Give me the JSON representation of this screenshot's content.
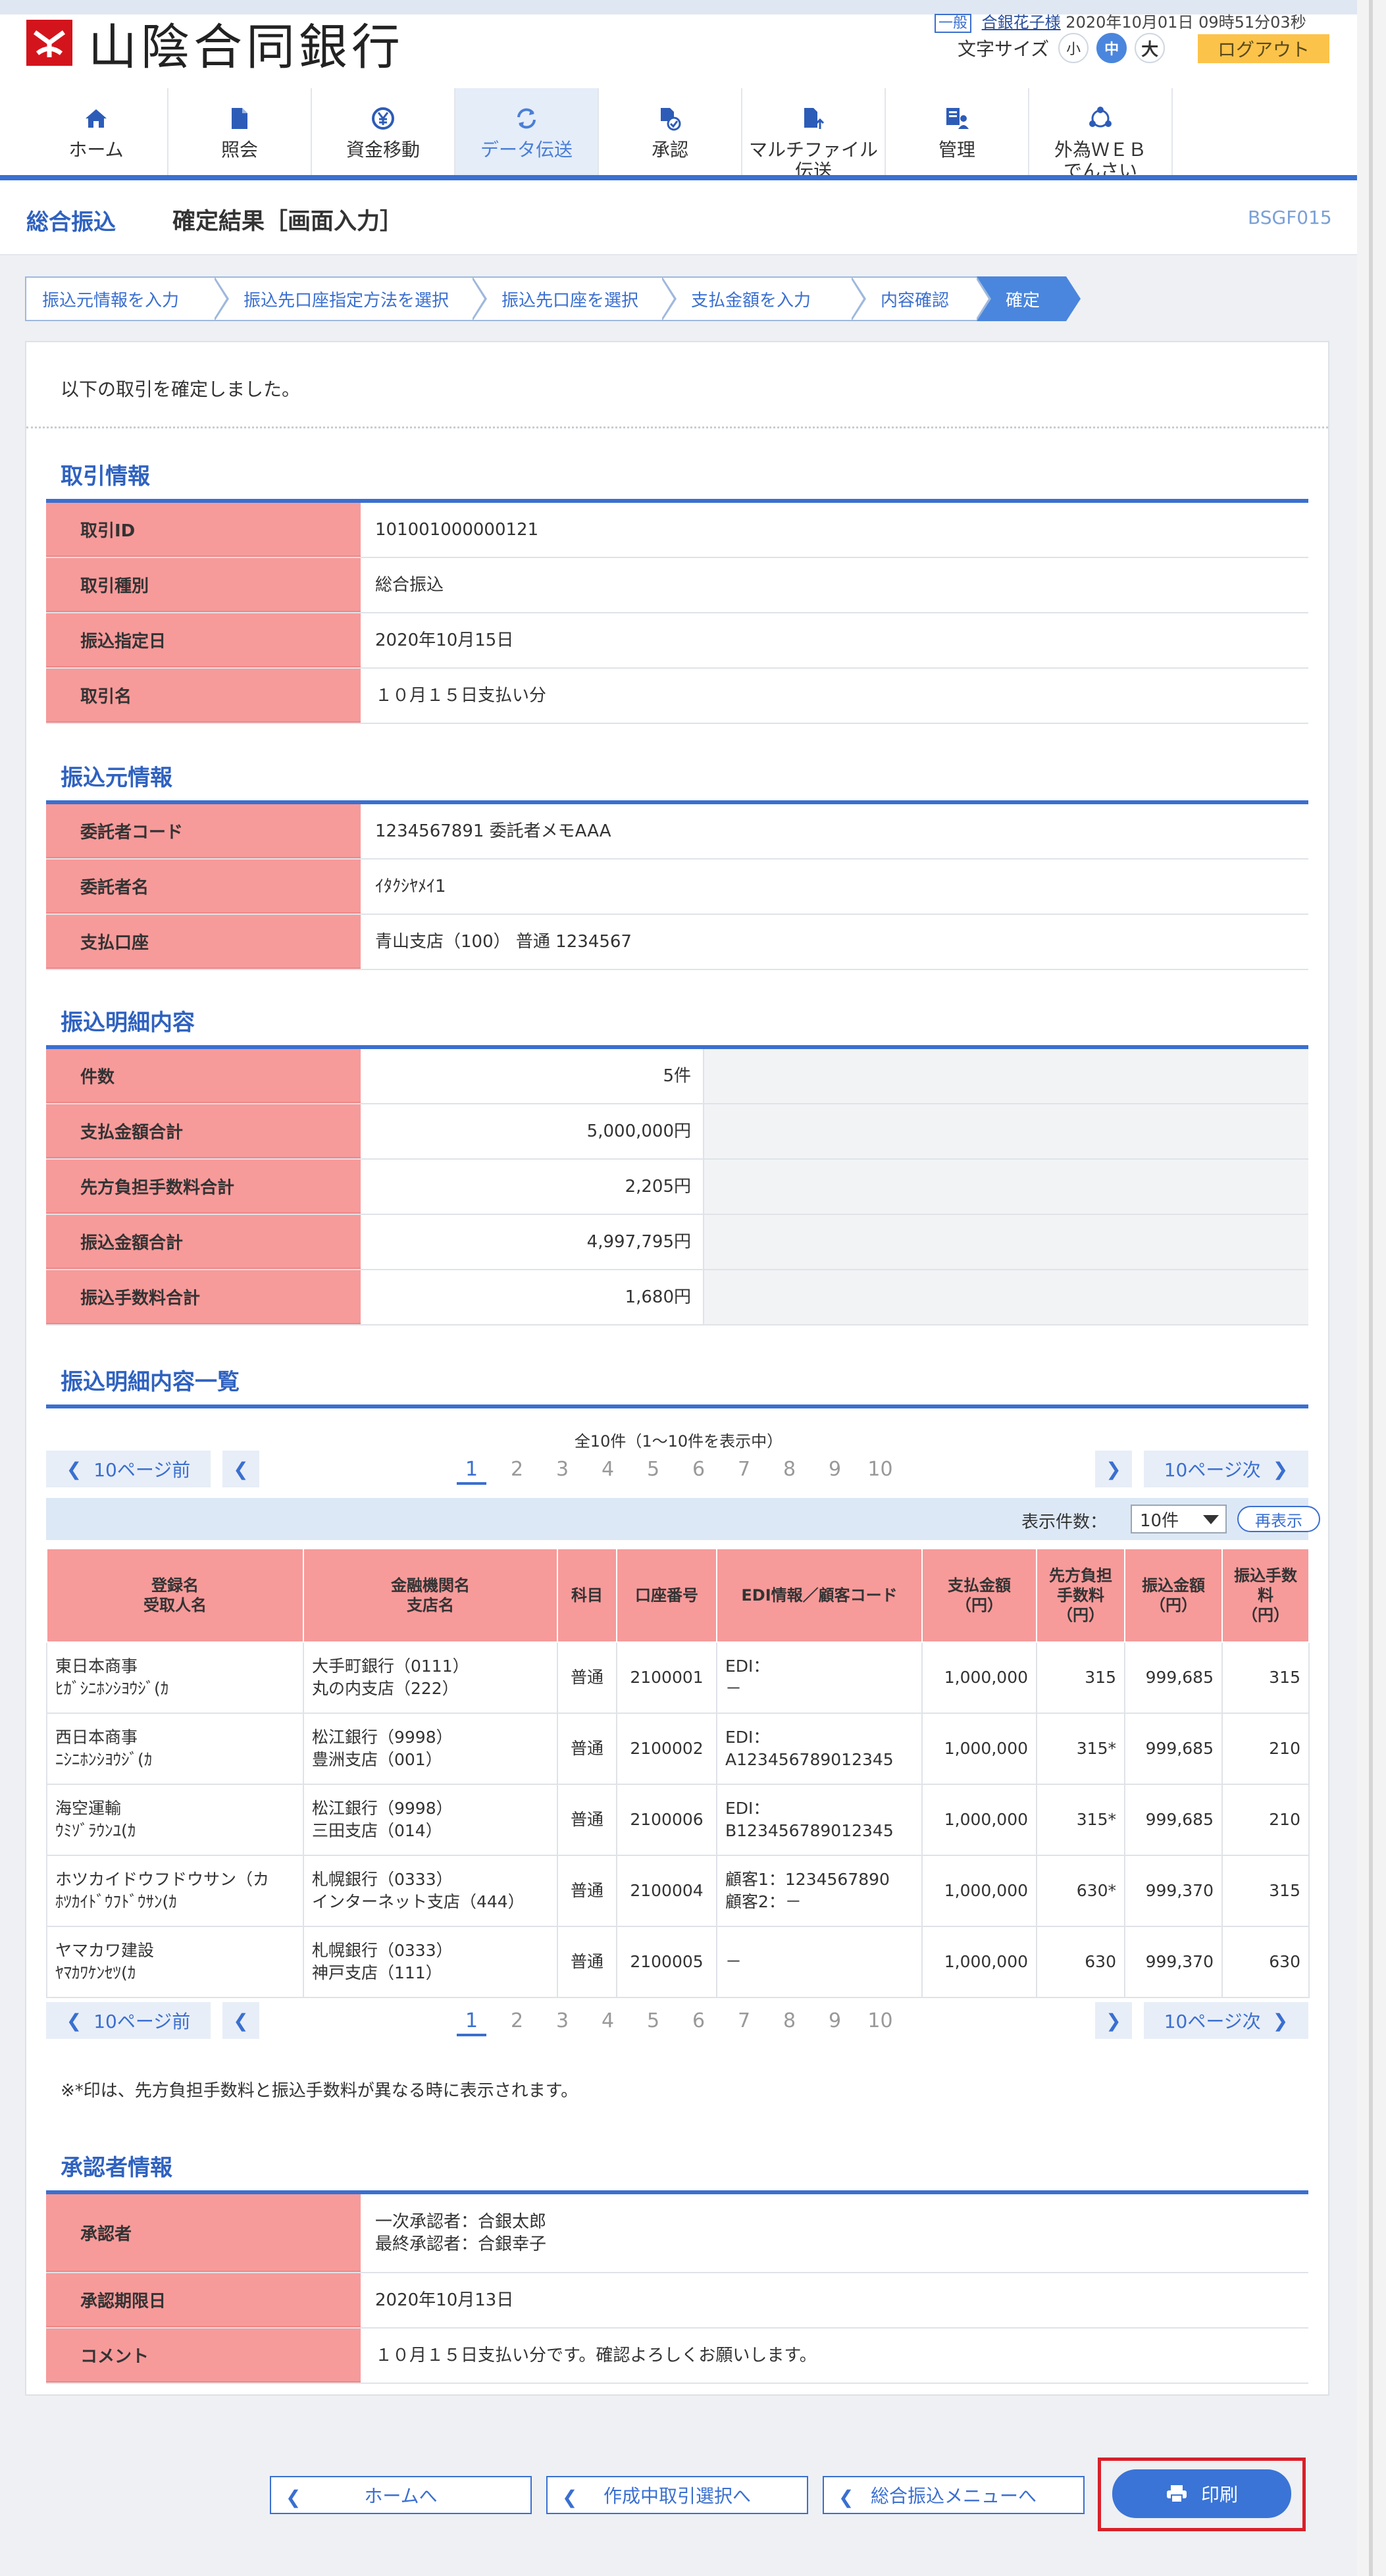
{
  "header": {
    "logo_text": "山陰合同銀行",
    "user_tag": "一般",
    "user_name": "合銀花子様",
    "login_time": "2020年10月01日 09時51分03秒",
    "font_size_label": "文字サイズ",
    "font_small": "小",
    "font_medium": "中",
    "font_large": "大",
    "logout_label": "ログアウト"
  },
  "nav": [
    {
      "label": "ホーム",
      "icon": "home-icon"
    },
    {
      "label": "照会",
      "icon": "document-icon"
    },
    {
      "label": "資金移動",
      "icon": "yen-transfer-icon"
    },
    {
      "label": "データ伝送",
      "icon": "refresh-icon"
    },
    {
      "label": "承認",
      "icon": "approve-document-icon"
    },
    {
      "label": "マルチファイル\n伝送",
      "icon": "file-upload-icon"
    },
    {
      "label": "管理",
      "icon": "admin-icon"
    },
    {
      "label": "外為ＷＥＢ\nでんさい",
      "icon": "globe-link-icon"
    }
  ],
  "titlebar": {
    "category": "総合振込",
    "title": "確定結果［画面入力］",
    "screen_code": "BSGF015"
  },
  "steps": [
    "振込元情報を入力",
    "振込先口座指定方法を選択",
    "振込先口座を選択",
    "支払金額を入力",
    "内容確認",
    "確定"
  ],
  "message": "以下の取引を確定しました。",
  "transaction": {
    "title": "取引情報",
    "rows": [
      {
        "key": "取引ID",
        "value": "101001000000121"
      },
      {
        "key": "取引種別",
        "value": "総合振込"
      },
      {
        "key": "振込指定日",
        "value": "2020年10月15日"
      },
      {
        "key": "取引名",
        "value": "１０月１５日支払い分"
      }
    ]
  },
  "source": {
    "title": "振込元情報",
    "rows": [
      {
        "key": "委託者コード",
        "value": "1234567891 委託者メモAAA"
      },
      {
        "key": "委託者名",
        "value": "ｲﾀｸｼﾔﾒｲ1"
      },
      {
        "key": "支払口座",
        "value": "青山支店（100） 普通 1234567"
      }
    ]
  },
  "summary": {
    "title": "振込明細内容",
    "rows": [
      {
        "key": "件数",
        "value": "5件"
      },
      {
        "key": "支払金額合計",
        "value": "5,000,000円"
      },
      {
        "key": "先方負担手数料合計",
        "value": "2,205円"
      },
      {
        "key": "振込金額合計",
        "value": "4,997,795円"
      },
      {
        "key": "振込手数料合計",
        "value": "1,680円"
      }
    ]
  },
  "details": {
    "title": "振込明細内容一覧",
    "info": "全10件（1～10件を表示中）",
    "prev10": "10ページ前",
    "next10": "10ページ次",
    "pages": [
      "1",
      "2",
      "3",
      "4",
      "5",
      "6",
      "7",
      "8",
      "9",
      "10"
    ],
    "current_page": "1",
    "display_count_label": "表示件数：",
    "display_count": "10件",
    "redisplay": "再表示",
    "headers": [
      "登録名\n受取人名",
      "金融機関名\n支店名",
      "科目",
      "口座番号",
      "EDI情報／顧客コード",
      "支払金額\n（円）",
      "先方負担\n手数料\n（円）",
      "振込金額\n（円）",
      "振込手数\n料\n（円）"
    ],
    "rows": [
      [
        "東日本商事\nﾋｶﾞｼﾆﾎﾝｼﾖｳｼﾞ(ｶ",
        "大手町銀行（0111）\n丸の内支店（222）",
        "普通",
        "2100001",
        "EDI：\n－",
        "1,000,000",
        "315",
        "999,685",
        "315"
      ],
      [
        "西日本商事\nﾆｼﾆﾎﾝｼﾖｳｼﾞ(ｶ",
        "松江銀行（9998）\n豊洲支店（001）",
        "普通",
        "2100002",
        "EDI：\nA123456789012345",
        "1,000,000",
        "315*",
        "999,685",
        "210"
      ],
      [
        "海空運輸\nｳﾐｿﾞﾗｳﾝﾕ(ｶ",
        "松江銀行（9998）\n三田支店（014）",
        "普通",
        "2100006",
        "EDI：\nB123456789012345",
        "1,000,000",
        "315*",
        "999,685",
        "210"
      ],
      [
        "ホツカイドウフドウサン（カ\nﾎﾂｶｲﾄﾞｳﾌﾄﾞｳｻﾝ(ｶ",
        "札幌銀行（0333）\nインターネット支店（444）",
        "普通",
        "2100004",
        "顧客1：1234567890\n顧客2：－",
        "1,000,000",
        "630*",
        "999,370",
        "315"
      ],
      [
        "ヤマカワ建設\nﾔﾏｶﾜｹﾝｾﾂ(ｶ",
        "札幌銀行（0333）\n神戸支店（111）",
        "普通",
        "2100005",
        "－",
        "1,000,000",
        "630",
        "999,370",
        "630"
      ]
    ],
    "note": "※*印は、先方負担手数料と振込手数料が異なる時に表示されます。"
  },
  "approver": {
    "title": "承認者情報",
    "rows": [
      {
        "key": "承認者",
        "value": "一次承認者：合銀太郎\n最終承認者：合銀幸子"
      },
      {
        "key": "承認期限日",
        "value": "2020年10月13日"
      },
      {
        "key": "コメント",
        "value": "１０月１５日支払い分です。確認よろしくお願いします。"
      }
    ]
  },
  "buttons": {
    "home": "ホームへ",
    "in_progress": "作成中取引選択へ",
    "menu": "総合振込メニューへ",
    "print": "印刷"
  },
  "colors": {
    "accent": "#3a6fd0",
    "key_cell": "#f79a9a",
    "logout": "#fcc34a",
    "highlight_frame": "#d8202a"
  }
}
